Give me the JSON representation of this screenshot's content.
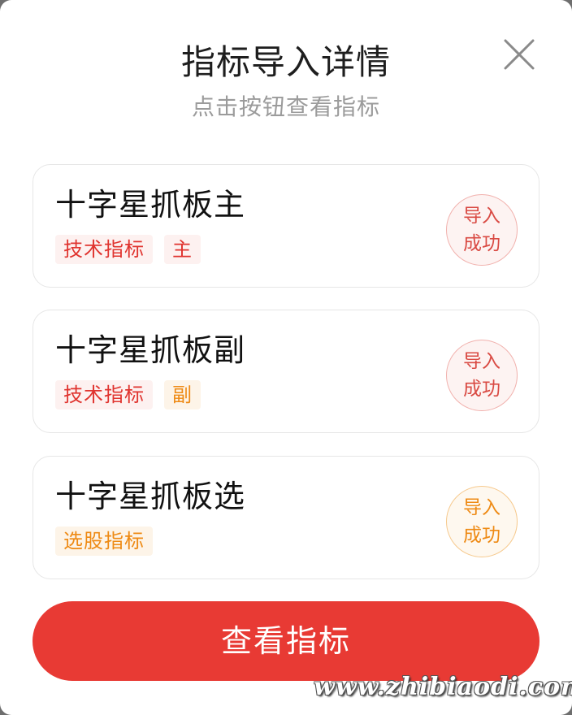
{
  "modal": {
    "title": "指标导入详情",
    "subtitle": "点击按钮查看指标",
    "close_icon": "close-icon"
  },
  "cards": [
    {
      "name": "十字星抓板主",
      "tags": [
        {
          "label": "技术指标",
          "color": "red"
        },
        {
          "label": "主",
          "color": "red"
        }
      ],
      "status_line1": "导入",
      "status_line2": "成功",
      "status_color": "red"
    },
    {
      "name": "十字星抓板副",
      "tags": [
        {
          "label": "技术指标",
          "color": "red"
        },
        {
          "label": "副",
          "color": "orange"
        }
      ],
      "status_line1": "导入",
      "status_line2": "成功",
      "status_color": "red"
    },
    {
      "name": "十字星抓板选",
      "tags": [
        {
          "label": "选股指标",
          "color": "orange"
        }
      ],
      "status_line1": "导入",
      "status_line2": "成功",
      "status_color": "orange"
    }
  ],
  "actions": {
    "view_label": "查看指标"
  },
  "watermark": "www.zhibiaodi.com",
  "colors": {
    "accent_red": "#e83a34",
    "tag_red": "#e0342f",
    "tag_orange": "#ee8a14"
  }
}
